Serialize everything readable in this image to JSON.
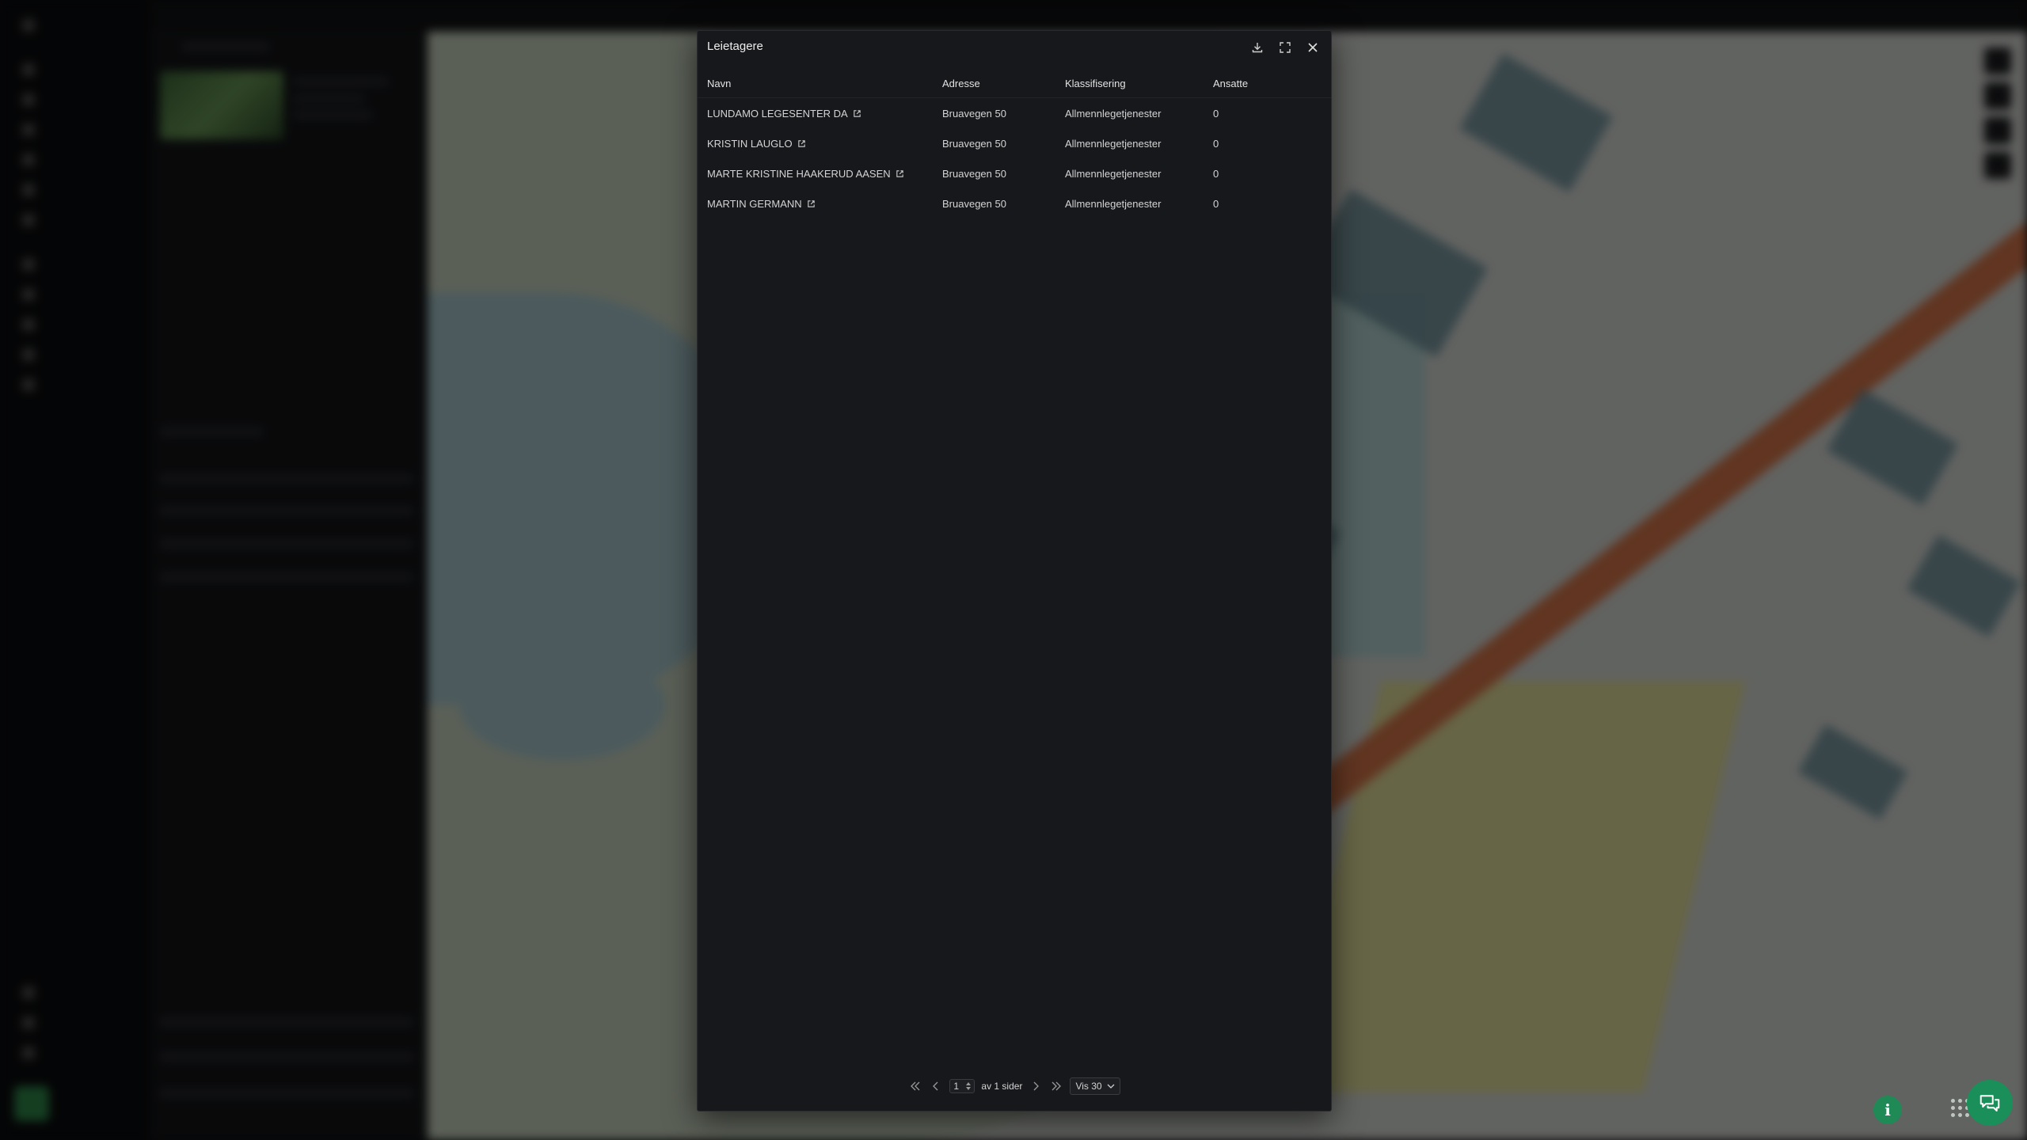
{
  "modal": {
    "title": "Leietagere",
    "columns": [
      "Navn",
      "Adresse",
      "Klassifisering",
      "Ansatte"
    ],
    "rows": [
      {
        "navn": "LUNDAMO LEGESENTER DA",
        "adresse": "Bruavegen 50",
        "klassifisering": "Allmennlegetjenester",
        "ansatte": "0"
      },
      {
        "navn": "KRISTIN LAUGLO",
        "adresse": "Bruavegen 50",
        "klassifisering": "Allmennlegetjenester",
        "ansatte": "0"
      },
      {
        "navn": "MARTE KRISTINE HAAKERUD AASEN",
        "adresse": "Bruavegen 50",
        "klassifisering": "Allmennlegetjenester",
        "ansatte": "0"
      },
      {
        "navn": "MARTIN GERMANN",
        "adresse": "Bruavegen 50",
        "klassifisering": "Allmennlegetjenester",
        "ansatte": "0"
      }
    ],
    "pager": {
      "page": "1",
      "of_label": "av 1 sider",
      "page_size_label": "Vis 30"
    }
  },
  "icons": {
    "download": "download-icon",
    "expand": "expand-icon",
    "close": "close-icon",
    "external": "external-link-icon",
    "first": "first-page-icon",
    "prev": "prev-page-icon",
    "next": "next-page-icon",
    "last": "last-page-icon",
    "info": "info-icon",
    "chat": "chat-icon",
    "apps": "apps-grid-icon"
  },
  "colors": {
    "accent_green": "#1a8f5a",
    "modal_bg": "#17181b"
  }
}
